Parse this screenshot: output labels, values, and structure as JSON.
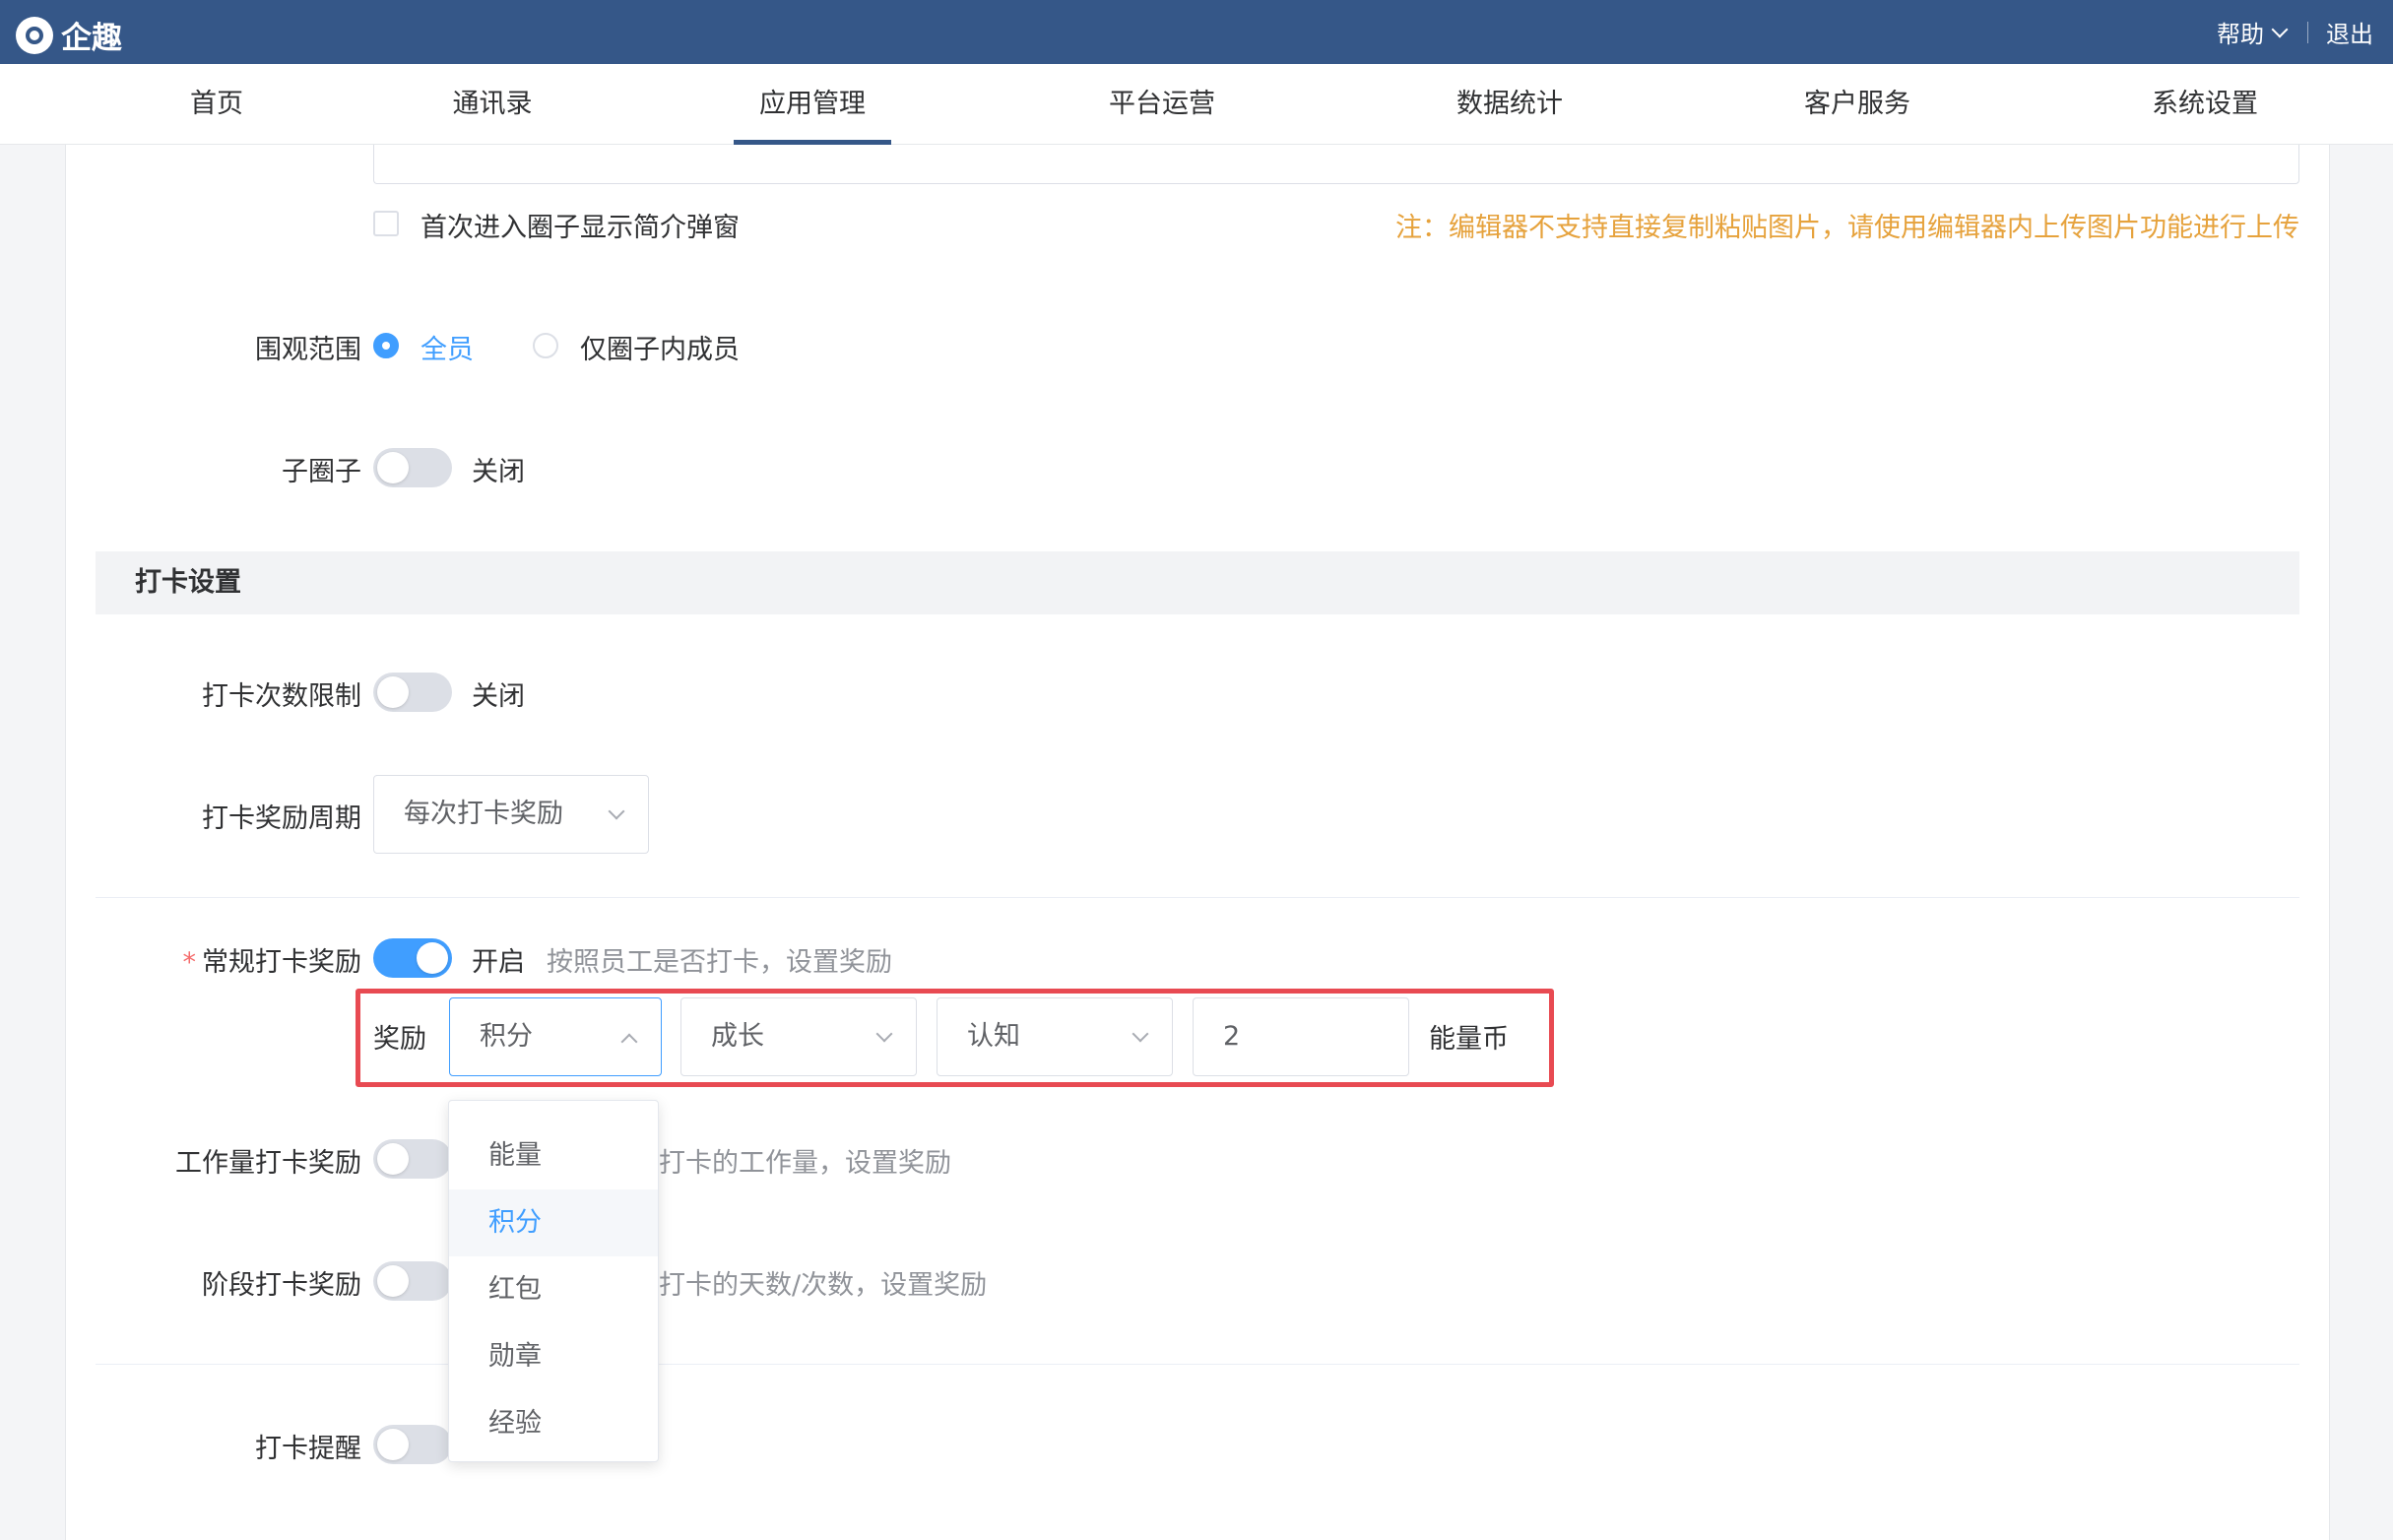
{
  "app": {
    "logo_text": "企趣"
  },
  "header": {
    "help": "帮助",
    "logout": "退出"
  },
  "nav": {
    "items": [
      "首页",
      "通讯录",
      "应用管理",
      "平台运营",
      "数据统计",
      "客户服务",
      "系统设置"
    ],
    "active": "应用管理"
  },
  "intro_popup": {
    "label": "首次进入圈子显示简介弹窗",
    "checked": false
  },
  "editor_note": "注：编辑器不支持直接复制粘贴图片，请使用编辑器内上传图片功能进行上传",
  "view_scope": {
    "label": "围观范围",
    "options": [
      "全员",
      "仅圈子内成员"
    ],
    "selected": "全员"
  },
  "sub_circle": {
    "label": "子圈子",
    "status": "关闭",
    "on": false
  },
  "checkin_section": {
    "title": "打卡设置"
  },
  "checkin_limit": {
    "label": "打卡次数限制",
    "status": "关闭",
    "on": false
  },
  "reward_period": {
    "label": "打卡奖励周期",
    "value": "每次打卡奖励"
  },
  "regular_reward": {
    "label": "常规打卡奖励",
    "required": "*",
    "status": "开启",
    "on": true,
    "desc": "按照员工是否打卡，设置奖励",
    "reward_label": "奖励",
    "type_value": "积分",
    "category_value": "成长",
    "sub_value": "认知",
    "amount": "2",
    "unit": "能量币"
  },
  "workload_reward": {
    "label": "工作量打卡奖励",
    "on": false,
    "desc_partial": "打卡的工作量，设置奖励"
  },
  "stage_reward": {
    "label": "阶段打卡奖励",
    "on": false,
    "desc_partial": "打卡的天数/次数，设置奖励"
  },
  "reminder": {
    "label": "打卡提醒",
    "on": false
  },
  "dropdown": {
    "options": [
      "能量",
      "积分",
      "红包",
      "勋章",
      "经验"
    ],
    "selected": "积分"
  },
  "colors": {
    "header_bg": "#355788",
    "accent": "#409eff",
    "warning": "#e6a23c",
    "highlight_border": "#e84a52"
  }
}
